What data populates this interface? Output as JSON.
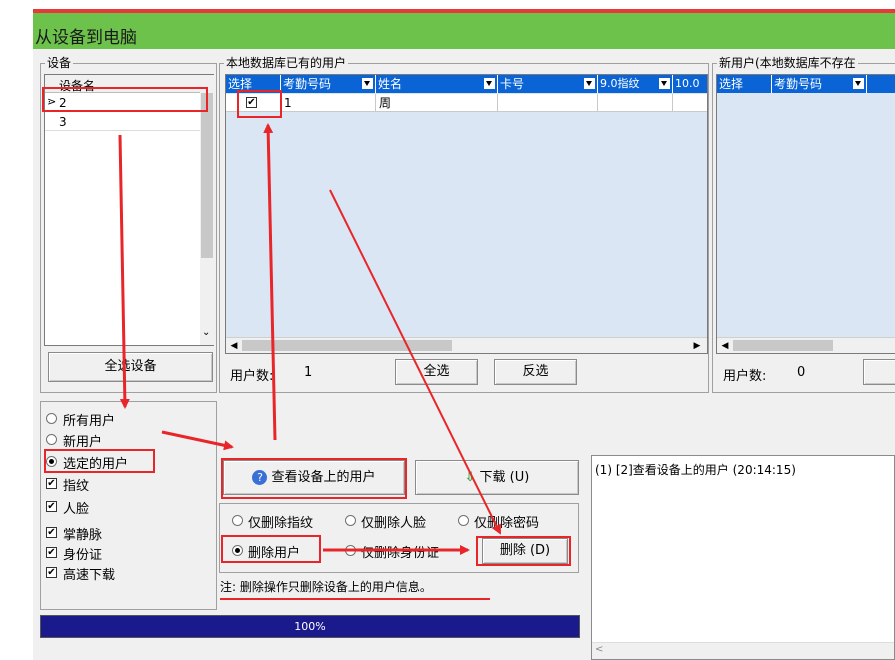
{
  "window": {
    "title": "从设备到电脑"
  },
  "device_group": {
    "title": "设备",
    "header": "设备名",
    "items": [
      {
        "marker": "⋗",
        "label": "2"
      },
      {
        "marker": "",
        "label": "3"
      }
    ],
    "select_all_button": "全选设备"
  },
  "local_users": {
    "title": "本地数据库已有的用户",
    "columns": [
      "选择",
      "考勤号码",
      "姓名",
      "卡号",
      "9.0指纹",
      "10.0"
    ],
    "rows": [
      {
        "checked": "✔",
        "id": "1",
        "name": "周"
      }
    ],
    "count_label": "用户数:",
    "count_value": "1",
    "select_all": "全选",
    "invert": "反选"
  },
  "new_users": {
    "title": "新用户(本地数据库不存在",
    "columns": [
      "选择",
      "考勤号码"
    ],
    "count_label": "用户数:",
    "count_value": "0"
  },
  "options": {
    "radios": [
      {
        "label": "所有用户",
        "checked": false
      },
      {
        "label": "新用户",
        "checked": false
      },
      {
        "label": "选定的用户",
        "checked": true
      }
    ],
    "checks": [
      {
        "label": "指纹",
        "checked": true
      },
      {
        "label": "人脸",
        "checked": true
      },
      {
        "label": "掌静脉",
        "checked": true
      },
      {
        "label": "身份证",
        "checked": true
      },
      {
        "label": "高速下载",
        "checked": true
      }
    ]
  },
  "actions": {
    "view_button": "查看设备上的用户",
    "download_button": "下载 (U)",
    "delete_options": [
      {
        "label": "仅删除指纹",
        "checked": false
      },
      {
        "label": "仅删除人脸",
        "checked": false
      },
      {
        "label": "仅删除密码",
        "checked": false
      },
      {
        "label": "删除用户",
        "checked": true
      },
      {
        "label": "仅删除身份证",
        "checked": false
      }
    ],
    "delete_button": "删除 (D)",
    "note": "注: 删除操作只删除设备上的用户信息。"
  },
  "progress": {
    "label": "100%",
    "value": 1.0
  },
  "log": {
    "entries": [
      "(1) [2]查看设备上的用户 (20:14:15)"
    ]
  },
  "colors": {
    "title_bg": "#6cc24a",
    "grid_header": "#0a64d6",
    "grid_bg": "#dbe6f4",
    "progress": "#1a1a8c",
    "annotation": "#e8262a"
  }
}
